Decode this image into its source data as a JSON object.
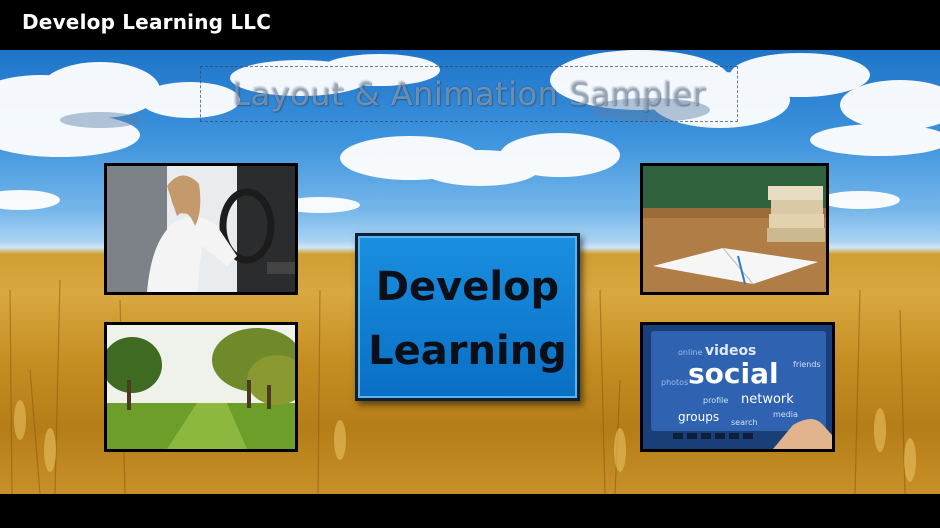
{
  "window": {
    "title": "Develop Learning LLC"
  },
  "slide": {
    "header_title": "Layout & Animation Sampler",
    "center_tile": {
      "line1": "Develop",
      "line2": "Learning"
    },
    "thumbnails": [
      {
        "name": "driving",
        "subject": "woman driving car"
      },
      {
        "name": "study",
        "subject": "books and notebook on desk"
      },
      {
        "name": "park",
        "subject": "tree-lined park path"
      },
      {
        "name": "social",
        "subject": "social network tablet",
        "words": [
          "videos",
          "social",
          "network",
          "groups",
          "online",
          "photos",
          "friends",
          "media",
          "profile",
          "search"
        ]
      }
    ]
  },
  "colors": {
    "tile_blue": "#0a6fc4",
    "bar": "#000000",
    "title_text": "#ffffff"
  }
}
